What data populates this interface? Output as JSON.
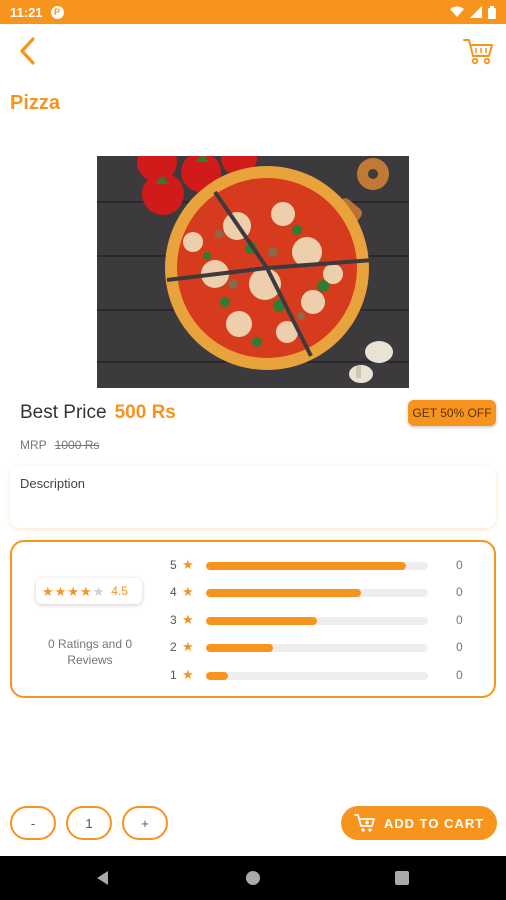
{
  "status_bar": {
    "time": "11:21",
    "app_badge": "P"
  },
  "header": {
    "title": "Pizza"
  },
  "product": {
    "price_label": "Best Price",
    "price_value": "500 Rs",
    "discount_badge": "GET 50% OFF",
    "mrp_label": "MRP",
    "mrp_value": "1000 Rs"
  },
  "description": {
    "title": "Description"
  },
  "ratings": {
    "average": "4.5",
    "average_stars": 4.5,
    "summary": "0 Ratings and 0 Reviews",
    "bars": [
      {
        "star": "5",
        "fill": 0.9,
        "count": "0"
      },
      {
        "star": "4",
        "fill": 0.7,
        "count": "0"
      },
      {
        "star": "3",
        "fill": 0.5,
        "count": "0"
      },
      {
        "star": "2",
        "fill": 0.3,
        "count": "0"
      },
      {
        "star": "1",
        "fill": 0.1,
        "count": "0"
      }
    ]
  },
  "quantity": {
    "minus": "-",
    "value": "1",
    "plus": "+"
  },
  "add_to_cart": {
    "label": "ADD TO CART"
  },
  "colors": {
    "accent": "#f7941d",
    "star_off": "#cfcfcf"
  },
  "icons": {
    "back": "chevron-left-icon",
    "cart": "cart-icon",
    "star": "star-icon",
    "add_cart": "cart-plus-icon"
  }
}
